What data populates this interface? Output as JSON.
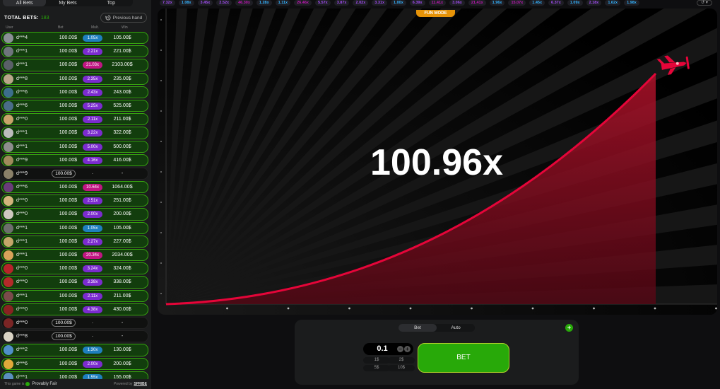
{
  "tabs": [
    "All Bets",
    "My Bets",
    "Top"
  ],
  "total_bets": {
    "label": "TOTAL BETS:",
    "value": "183"
  },
  "previous_hand": "Previous hand",
  "columns": [
    "User",
    "Bet",
    "Mult.",
    "Win"
  ],
  "bets": [
    {
      "user": "d***4",
      "bet": "100.00$",
      "mult": "1.05x",
      "win": "105.00$",
      "mult_color": "#1e7fbf",
      "avatar": "#8a8f96"
    },
    {
      "user": "d***1",
      "bet": "100.00$",
      "mult": "2.21x",
      "win": "221.00$",
      "mult_color": "#7b2bcf",
      "avatar": "#6e747c"
    },
    {
      "user": "d***1",
      "bet": "100.00$",
      "mult": "21.03x",
      "win": "2103.00$",
      "mult_color": "#c11583",
      "avatar": "#5a6068"
    },
    {
      "user": "d***8",
      "bet": "100.00$",
      "mult": "2.35x",
      "win": "235.00$",
      "mult_color": "#7b2bcf",
      "avatar": "#b9a68a"
    },
    {
      "user": "d***6",
      "bet": "100.00$",
      "mult": "2.43x",
      "win": "243.00$",
      "mult_color": "#7b2bcf",
      "avatar": "#3c6e8c"
    },
    {
      "user": "d***6",
      "bet": "100.00$",
      "mult": "5.25x",
      "win": "525.00$",
      "mult_color": "#7b2bcf",
      "avatar": "#4a6d88"
    },
    {
      "user": "d***0",
      "bet": "100.00$",
      "mult": "2.11x",
      "win": "211.00$",
      "mult_color": "#7b2bcf",
      "avatar": "#c9a36b"
    },
    {
      "user": "d***1",
      "bet": "100.00$",
      "mult": "3.22x",
      "win": "322.00$",
      "mult_color": "#7b2bcf",
      "avatar": "#bcbcbc"
    },
    {
      "user": "d***1",
      "bet": "100.00$",
      "mult": "5.00x",
      "win": "500.00$",
      "mult_color": "#7b2bcf",
      "avatar": "#8d8d8d"
    },
    {
      "user": "d***9",
      "bet": "100.00$",
      "mult": "4.16x",
      "win": "416.00$",
      "mult_color": "#7b2bcf",
      "avatar": "#a08a5c"
    },
    {
      "user": "d***9",
      "bet": "100.00$",
      "mult": "-",
      "win": "-",
      "mult_color": "",
      "avatar": "#8a8068",
      "pending": true
    },
    {
      "user": "d***6",
      "bet": "100.00$",
      "mult": "10.64x",
      "win": "1064.00$",
      "mult_color": "#c11583",
      "avatar": "#6a3c7a"
    },
    {
      "user": "d***0",
      "bet": "100.00$",
      "mult": "2.51x",
      "win": "251.00$",
      "mult_color": "#7b2bcf",
      "avatar": "#d3b37c"
    },
    {
      "user": "d***0",
      "bet": "100.00$",
      "mult": "2.00x",
      "win": "200.00$",
      "mult_color": "#7b2bcf",
      "avatar": "#cfc9c0"
    },
    {
      "user": "d***1",
      "bet": "100.00$",
      "mult": "1.05x",
      "win": "105.00$",
      "mult_color": "#1e7fbf",
      "avatar": "#6d6d6d"
    },
    {
      "user": "d***1",
      "bet": "100.00$",
      "mult": "2.27x",
      "win": "227.00$",
      "mult_color": "#7b2bcf",
      "avatar": "#c4a56a"
    },
    {
      "user": "d***1",
      "bet": "100.00$",
      "mult": "20.34x",
      "win": "2034.00$",
      "mult_color": "#c11583",
      "avatar": "#d9a25a"
    },
    {
      "user": "d***0",
      "bet": "100.00$",
      "mult": "3.24x",
      "win": "324.00$",
      "mult_color": "#7b2bcf",
      "avatar": "#b8232a"
    },
    {
      "user": "d***0",
      "bet": "100.00$",
      "mult": "3.38x",
      "win": "338.00$",
      "mult_color": "#7b2bcf",
      "avatar": "#b42a2a"
    },
    {
      "user": "d***1",
      "bet": "100.00$",
      "mult": "2.11x",
      "win": "211.00$",
      "mult_color": "#7b2bcf",
      "avatar": "#7a4b4b"
    },
    {
      "user": "d***0",
      "bet": "100.00$",
      "mult": "4.38x",
      "win": "430.00$",
      "mult_color": "#7b2bcf",
      "avatar": "#8a2222"
    },
    {
      "user": "d***0",
      "bet": "100.00$",
      "mult": "-",
      "win": "-",
      "mult_color": "",
      "avatar": "#7a2525",
      "pending": true
    },
    {
      "user": "d***8",
      "bet": "100.00$",
      "mult": "-",
      "win": "-",
      "mult_color": "",
      "avatar": "#d9d2c4",
      "pending": true
    },
    {
      "user": "d***2",
      "bet": "100.00$",
      "mult": "1.30x",
      "win": "130.00$",
      "mult_color": "#1e7fbf",
      "avatar": "#4f8fc9"
    },
    {
      "user": "d***6",
      "bet": "100.00$",
      "mult": "2.00x",
      "win": "200.00$",
      "mult_color": "#7b2bcf",
      "avatar": "#e0a93a"
    },
    {
      "user": "d***1",
      "bet": "100.00$",
      "mult": "1.55x",
      "win": "155.00$",
      "mult_color": "#1e7fbf",
      "avatar": "#5b8fbf"
    }
  ],
  "footer": {
    "game_is": "This game is",
    "provably_fair": "Provably Fair",
    "powered_by": "Powered by",
    "brand": "SPRIBE"
  },
  "history": [
    {
      "v": "7.32x",
      "c": "#a44df5"
    },
    {
      "v": "1.08x",
      "c": "#34b4ff"
    },
    {
      "v": "3.45x",
      "c": "#a44df5"
    },
    {
      "v": "2.52x",
      "c": "#a44df5"
    },
    {
      "v": "46.30x",
      "c": "#c017b4"
    },
    {
      "v": "1.28x",
      "c": "#34b4ff"
    },
    {
      "v": "1.11x",
      "c": "#34b4ff"
    },
    {
      "v": "26.46x",
      "c": "#c017b4"
    },
    {
      "v": "5.57x",
      "c": "#a44df5"
    },
    {
      "v": "3.87x",
      "c": "#a44df5"
    },
    {
      "v": "2.02x",
      "c": "#a44df5"
    },
    {
      "v": "3.31x",
      "c": "#a44df5"
    },
    {
      "v": "1.00x",
      "c": "#34b4ff"
    },
    {
      "v": "6.39x",
      "c": "#a44df5"
    },
    {
      "v": "11.41x",
      "c": "#c017b4"
    },
    {
      "v": "3.06x",
      "c": "#a44df5"
    },
    {
      "v": "21.41x",
      "c": "#c017b4"
    },
    {
      "v": "1.96x",
      "c": "#34b4ff"
    },
    {
      "v": "15.07x",
      "c": "#c017b4"
    },
    {
      "v": "1.45x",
      "c": "#34b4ff"
    },
    {
      "v": "6.37x",
      "c": "#a44df5"
    },
    {
      "v": "1.09x",
      "c": "#34b4ff"
    },
    {
      "v": "2.18x",
      "c": "#a44df5"
    },
    {
      "v": "1.62x",
      "c": "#34b4ff"
    },
    {
      "v": "1.98x",
      "c": "#34b4ff"
    }
  ],
  "history_menu": "↺ ▾",
  "game": {
    "fun_mode": "FUN MODE",
    "multiplier": "100.96x",
    "curve_progress": 1.0
  },
  "bet_panel": {
    "modes": [
      "Bet",
      "Auto"
    ],
    "add_icon": "+",
    "stake": "0.1",
    "minus": "−",
    "plus": "+",
    "quick": [
      "1$",
      "2$",
      "5$",
      "10$"
    ],
    "bet_label": "BET"
  },
  "colors": {
    "win_row": "#123d0d",
    "win_border": "#37a60f",
    "curve": "#e50539",
    "accent_green": "#28a909",
    "fun_mode": "#e69308"
  }
}
